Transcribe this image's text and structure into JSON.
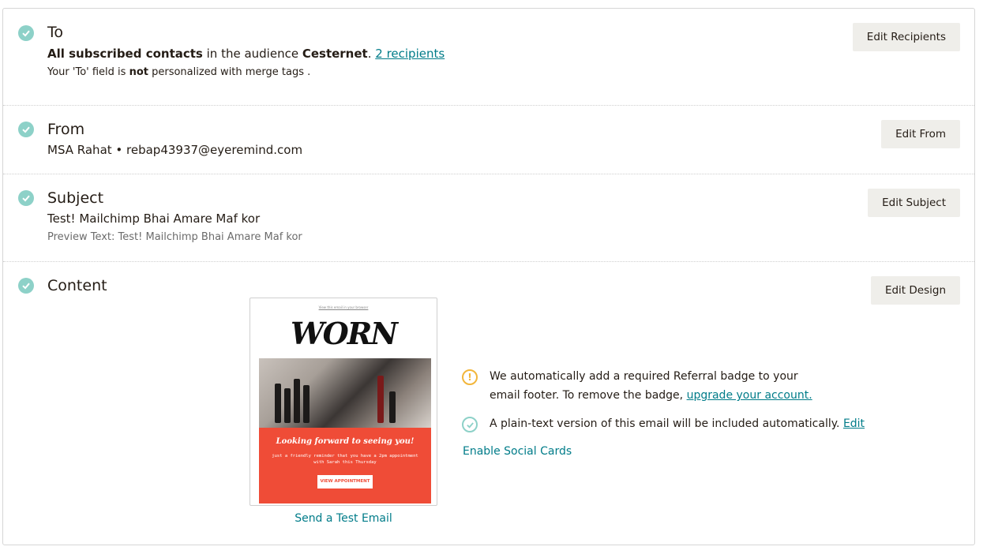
{
  "to": {
    "heading": "To",
    "audience_bold": "All subscribed contacts",
    "audience_mid": " in the audience ",
    "audience_name": "Cesternet",
    "audience_dot": ".",
    "recipients_link": "2 recipients",
    "note_pre": "Your 'To' field is ",
    "note_bold": "not",
    "note_post": " personalized with merge tags .",
    "edit_button": "Edit Recipients"
  },
  "from": {
    "heading": "From",
    "value": "MSA Rahat • rebap43937@eyeremind.com",
    "edit_button": "Edit From"
  },
  "subject": {
    "heading": "Subject",
    "value": "Test! Mailchimp Bhai Amare Maf kor",
    "preview_text": "Preview Text: Test! Mailchimp Bhai Amare Maf kor",
    "edit_button": "Edit Subject"
  },
  "content": {
    "heading": "Content",
    "edit_button": "Edit Design",
    "preview": {
      "view_link": "View this email in your browser",
      "logo": "WORN",
      "promo_title": "Looking forward to seeing you!",
      "promo_body": "just a friendly reminder that you have a 2pm appointment with Sarah this Thursday",
      "promo_button": "VIEW APPOINTMENT"
    },
    "send_test": "Send a Test Email",
    "referral_notice_pre": "We automatically add a required Referral badge to your email footer. To remove the badge, ",
    "referral_link": "upgrade your account.",
    "plaintext_notice": "A plain-text version of this email will be included automatically. ",
    "plaintext_edit": "Edit",
    "social_cards": "Enable Social Cards"
  },
  "colors": {
    "accent_teal": "#007c89",
    "check_green": "#8dd1c8",
    "warning_yellow": "#f2b63b",
    "button_gray": "#efeeea",
    "promo_red": "#ef4c37"
  }
}
